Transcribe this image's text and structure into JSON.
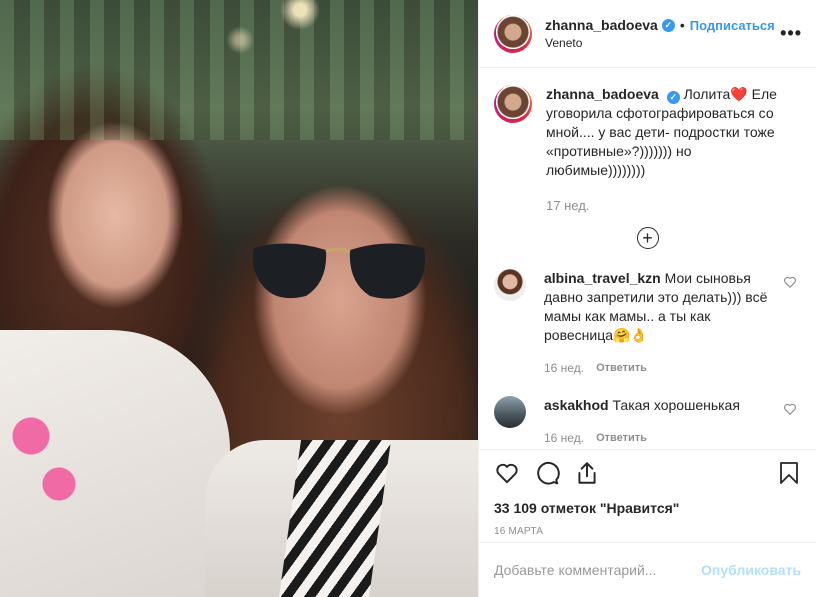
{
  "post": {
    "username": "zhanna_badoeva",
    "follow_label": "Подписаться",
    "dot": "•",
    "location": "Veneto",
    "more": "•••"
  },
  "caption": {
    "username": "zhanna_badoeva",
    "text": "Лолита❤️ Еле уговорила сфотографироваться со мной.... у вас дети- подростки тоже «противные»?))))))) но любимые))))))))",
    "time": "17 нед."
  },
  "load_more": "+",
  "comments": [
    {
      "username": "albina_travel_kzn",
      "text": "Мои сыновья давно запретили это делать))) всё мамы как мамы.. а ты как ровесница🤗👌",
      "time": "16 нед.",
      "reply": "Ответить"
    },
    {
      "username": "askakhod",
      "text": "Такая хорошенькая",
      "time": "16 нед.",
      "reply": "Ответить"
    }
  ],
  "likes": "33 109 отметок \"Нравится\"",
  "date": "16 марта",
  "add_comment": {
    "placeholder": "Добавьте комментарий...",
    "publish": "Опубликовать"
  },
  "icons": {
    "verified": "✓",
    "like": "heart-icon",
    "comment": "comment-icon",
    "share": "share-icon",
    "save": "bookmark-icon"
  },
  "colors": {
    "accent": "#3897f0",
    "muted": "#8e8e8e",
    "publish_disabled": "#b2dffc"
  }
}
